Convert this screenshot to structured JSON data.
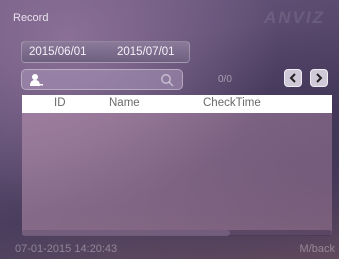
{
  "header": {
    "title": "Record",
    "brand": "ANVIZ"
  },
  "filters": {
    "start_date": "2015/06/01",
    "end_date": "2015/07/01"
  },
  "search": {
    "user_icon": "user-id-icon",
    "search_icon": "magnifier-icon",
    "value": ""
  },
  "pager": {
    "count": "0/0",
    "prev_icon": "chevron-left-icon",
    "next_icon": "chevron-right-icon"
  },
  "table": {
    "columns": [
      "ID",
      "Name",
      "CheckTime"
    ],
    "rows": []
  },
  "footer": {
    "datetime": "07-01-2015 14:20:43",
    "back_label": "M/back"
  }
}
